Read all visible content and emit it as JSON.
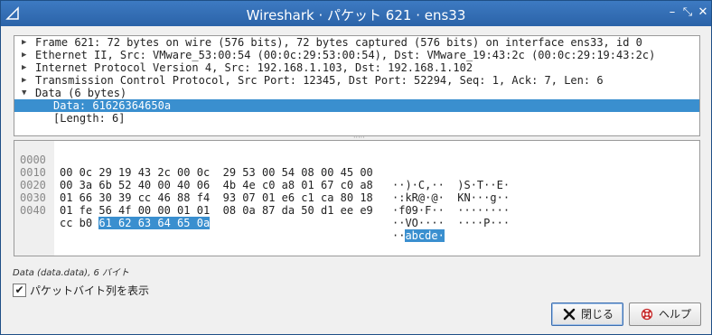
{
  "window": {
    "title": "Wireshark · パケット 621 · ens33"
  },
  "tree": [
    {
      "text": "Frame 621: 72 bytes on wire (576 bits), 72 bytes captured (576 bits) on interface ens33, id 0",
      "expanded": false
    },
    {
      "text": "Ethernet II, Src: VMware_53:00:54 (00:0c:29:53:00:54), Dst: VMware_19:43:2c (00:0c:29:19:43:2c)",
      "expanded": false
    },
    {
      "text": "Internet Protocol Version 4, Src: 192.168.1.103, Dst: 192.168.1.102",
      "expanded": false
    },
    {
      "text": "Transmission Control Protocol, Src Port: 12345, Dst Port: 52294, Seq: 1, Ack: 7, Len: 6",
      "expanded": false
    },
    {
      "text": "Data (6 bytes)",
      "expanded": true
    },
    {
      "text": "Data: 61626364650a",
      "child": true,
      "selected": true
    },
    {
      "text": "[Length: 6]",
      "child": true
    }
  ],
  "bytes": [
    {
      "offset": "0000",
      "hex": "00 0c 29 19 43 2c 00 0c  29 53 00 54 08 00 45 00",
      "ascii": "··)·C,··  )S·T··E·"
    },
    {
      "offset": "0010",
      "hex": "00 3a 6b 52 40 00 40 06  4b 4e c0 a8 01 67 c0 a8",
      "ascii": "·:kR@·@·  KN···g··"
    },
    {
      "offset": "0020",
      "hex": "01 66 30 39 cc 46 88 f4  93 07 01 e6 c1 ca 80 18",
      "ascii": "·f09·F··  ········"
    },
    {
      "offset": "0030",
      "hex": "01 fe 56 4f 00 00 01 01  08 0a 87 da 50 d1 ee e9",
      "ascii": "··VO····  ····P···"
    },
    {
      "offset": "0040",
      "hex_plain": "cc b0 ",
      "hex_hl": "61 62 63 64 65 0a",
      "ascii_plain": "··",
      "ascii_hl": "abcde·"
    }
  ],
  "status_text": "Data (data.data), 6 バイト",
  "show_bytes_checkbox": {
    "label": "パケットバイト列を表示",
    "checked": true
  },
  "buttons": {
    "close_label": "閉じる",
    "help_label": "ヘルプ"
  },
  "icons": {
    "app": "wireshark-fin-icon",
    "close": "close-x-icon",
    "help": "help-lifebuoy-icon"
  },
  "colors": {
    "titlebar": "#2b63a8",
    "selection": "#3a8fcf"
  }
}
